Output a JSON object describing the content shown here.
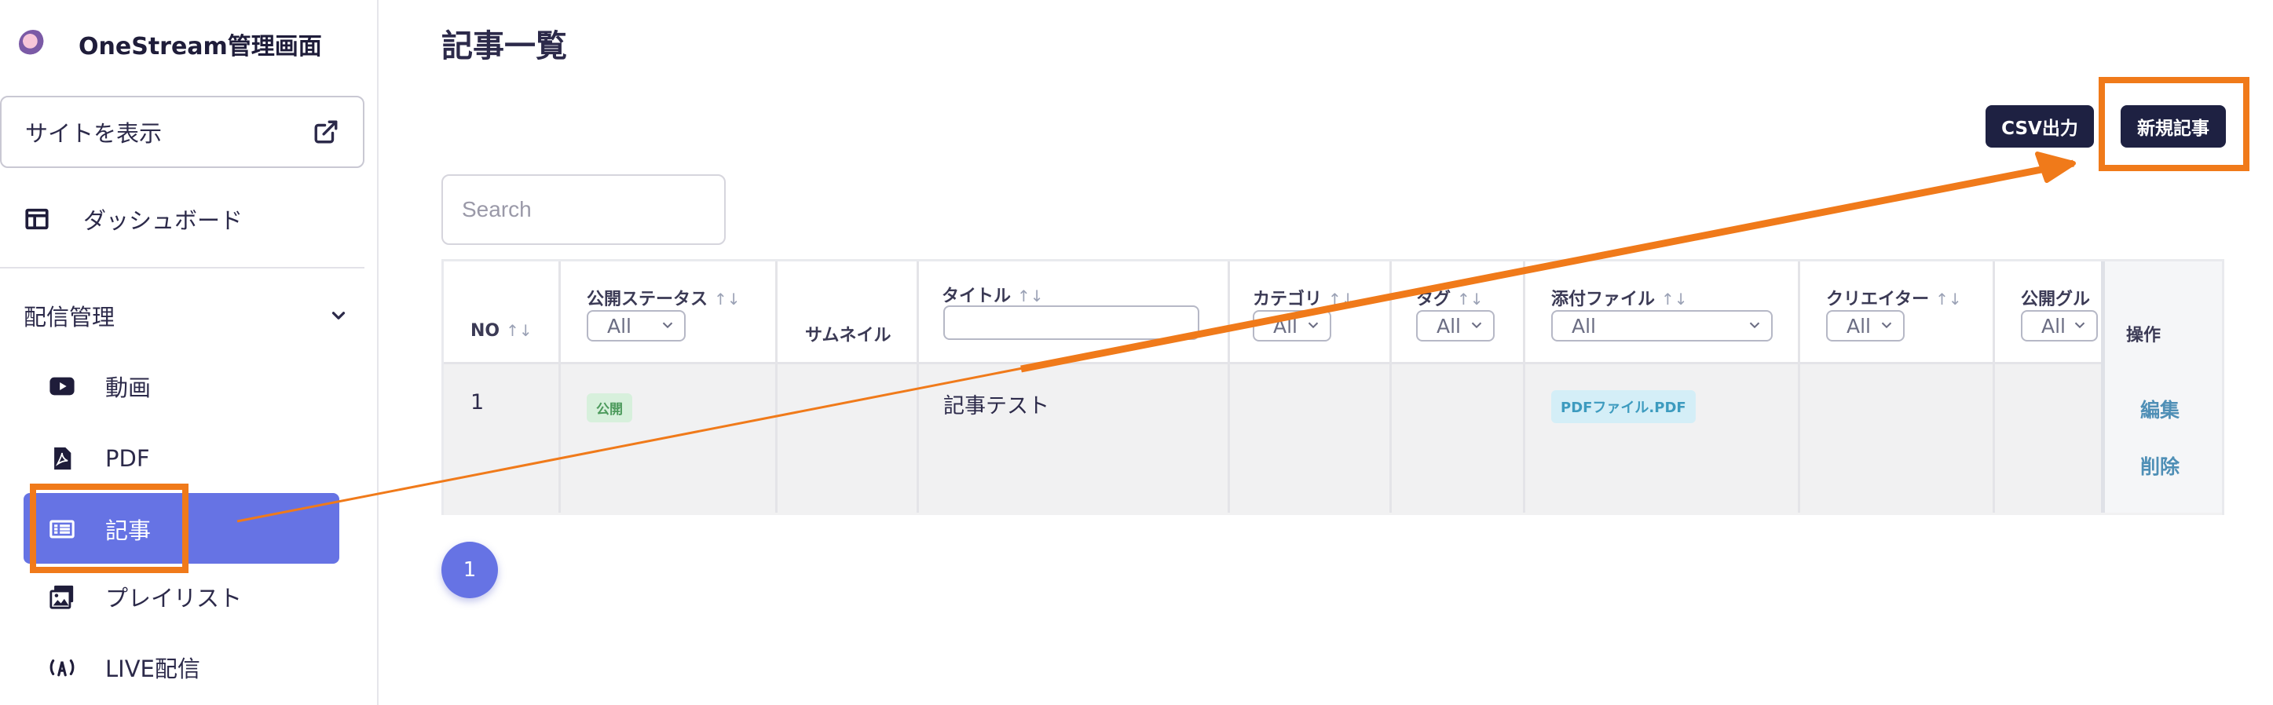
{
  "app": {
    "title": "OneStream管理画面"
  },
  "sidebar": {
    "site_button_label": "サイトを表示",
    "dashboard_label": "ダッシュボード",
    "section_label": "配信管理",
    "items": [
      {
        "label": "動画",
        "icon": "youtube-icon"
      },
      {
        "label": "PDF",
        "icon": "pdf-icon"
      },
      {
        "label": "記事",
        "icon": "article-icon",
        "active": true
      },
      {
        "label": "プレイリスト",
        "icon": "playlist-icon"
      },
      {
        "label": "LIVE配信",
        "icon": "live-broadcast-icon"
      }
    ]
  },
  "main": {
    "page_title": "記事一覧",
    "csv_button_label": "CSV出力",
    "new_button_label": "新規記事",
    "search_placeholder": "Search",
    "table": {
      "columns": [
        {
          "label": "NO",
          "sortable": true
        },
        {
          "label": "公開ステータス",
          "sortable": true,
          "filter": "All"
        },
        {
          "label": "サムネイル",
          "sortable": false
        },
        {
          "label": "タイトル",
          "sortable": true,
          "filter": ""
        },
        {
          "label": "カテゴリ",
          "sortable": true,
          "filter": "All"
        },
        {
          "label": "タグ",
          "sortable": true,
          "filter": "All"
        },
        {
          "label": "添付ファイル",
          "sortable": true,
          "filter": "All"
        },
        {
          "label": "クリエイター",
          "sortable": true,
          "filter": "All"
        },
        {
          "label": "公開グル",
          "sortable": false,
          "filter": "All"
        },
        {
          "label": "操作",
          "sortable": false
        }
      ],
      "sort_glyph": "↑↓",
      "rows": [
        {
          "no": "1",
          "status": "公開",
          "title": "記事テスト",
          "attachment": "PDFファイル.PDF",
          "actions": [
            "編集",
            "削除"
          ]
        }
      ]
    },
    "pagination": {
      "current_page": "1"
    }
  },
  "colors": {
    "accent": "#6673e4",
    "dark_button": "#1e2142",
    "highlight": "#f07a1a"
  }
}
